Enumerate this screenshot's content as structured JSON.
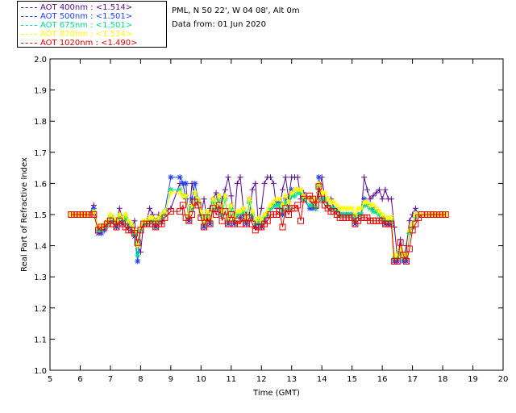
{
  "legend": [
    {
      "label": "AOT  400nm : <1.514>",
      "color": "#5a0a8c"
    },
    {
      "label": "AOT  500nm : <1.501>",
      "color": "#1e3cff"
    },
    {
      "label": "AOT  675nm : <1.501>",
      "color": "#00e08c"
    },
    {
      "label": "AOT  870nm : <1.514>",
      "color": "#ffff00"
    },
    {
      "label": "AOT 1020nm : <1.490>",
      "color": "#e60000"
    }
  ],
  "header": {
    "location": "PML, N 50 22', W 04 08', Alt 0m",
    "date": "Data from: 01 Jun 2020"
  },
  "chart_data": {
    "type": "line",
    "xlabel": "Time (GMT)",
    "ylabel": "Real Part of Refractive Index",
    "xlim": [
      5,
      20
    ],
    "ylim": [
      1.0,
      2.0
    ],
    "xticks": [
      "5",
      "6",
      "7",
      "8",
      "9",
      "10",
      "11",
      "12",
      "13",
      "14",
      "15",
      "16",
      "17",
      "18",
      "19",
      "20"
    ],
    "yticks": [
      "1.0",
      "1.1",
      "1.2",
      "1.3",
      "1.4",
      "1.5",
      "1.6",
      "1.7",
      "1.8",
      "1.9",
      "2.0"
    ],
    "x": [
      5.7,
      5.8,
      5.9,
      6.0,
      6.1,
      6.2,
      6.3,
      6.45,
      6.6,
      6.7,
      6.8,
      6.9,
      7.0,
      7.1,
      7.2,
      7.3,
      7.4,
      7.5,
      7.6,
      7.7,
      7.8,
      7.9,
      8.0,
      8.1,
      8.2,
      8.3,
      8.4,
      8.5,
      8.6,
      8.7,
      8.8,
      9.0,
      9.3,
      9.4,
      9.5,
      9.6,
      9.7,
      9.8,
      9.9,
      10.0,
      10.1,
      10.2,
      10.3,
      10.4,
      10.5,
      10.6,
      10.7,
      10.8,
      10.9,
      11.0,
      11.1,
      11.2,
      11.3,
      11.4,
      11.5,
      11.6,
      11.7,
      11.8,
      11.9,
      12.0,
      12.1,
      12.2,
      12.3,
      12.4,
      12.5,
      12.6,
      12.7,
      12.8,
      12.9,
      13.0,
      13.1,
      13.2,
      13.3,
      13.4,
      13.6,
      13.7,
      13.8,
      13.9,
      14.0,
      14.1,
      14.2,
      14.3,
      14.4,
      14.5,
      14.6,
      14.7,
      14.8,
      14.9,
      15.0,
      15.1,
      15.2,
      15.3,
      15.4,
      15.5,
      15.6,
      15.7,
      15.8,
      15.9,
      16.0,
      16.1,
      16.2,
      16.3,
      16.4,
      16.5,
      16.6,
      16.7,
      16.8,
      16.9,
      17.0,
      17.1,
      17.2,
      17.3,
      17.5,
      17.6,
      17.7,
      17.8,
      17.9,
      18.0,
      18.1,
      18.2,
      18.3
    ],
    "series": [
      {
        "values": [
          1.5,
          1.5,
          1.5,
          1.5,
          1.5,
          1.5,
          1.5,
          1.53,
          1.45,
          1.46,
          1.47,
          1.48,
          1.5,
          1.49,
          1.47,
          1.52,
          1.49,
          1.5,
          1.47,
          1.46,
          1.48,
          1.4,
          1.38,
          1.47,
          1.48,
          1.52,
          1.5,
          1.48,
          1.5,
          1.47,
          1.51,
          1.52,
          1.6,
          1.6,
          1.55,
          1.49,
          1.6,
          1.55,
          1.55,
          1.5,
          1.55,
          1.48,
          1.52,
          1.55,
          1.57,
          1.5,
          1.55,
          1.58,
          1.62,
          1.56,
          1.48,
          1.6,
          1.62,
          1.52,
          1.5,
          1.5,
          1.58,
          1.6,
          1.47,
          1.52,
          1.6,
          1.62,
          1.62,
          1.6,
          1.52,
          1.52,
          1.58,
          1.62,
          1.55,
          1.62,
          1.62,
          1.62,
          1.55,
          1.57,
          1.55,
          1.53,
          1.52,
          1.57,
          1.62,
          1.55,
          1.55,
          1.55,
          1.52,
          1.52,
          1.5,
          1.5,
          1.5,
          1.5,
          1.5,
          1.48,
          1.5,
          1.5,
          1.62,
          1.58,
          1.55,
          1.56,
          1.57,
          1.58,
          1.55,
          1.58,
          1.55,
          1.55,
          1.46,
          1.36,
          1.42,
          1.36,
          1.4,
          1.48,
          1.5,
          1.52,
          1.5,
          1.5,
          1.5,
          1.5,
          1.5,
          1.5,
          1.5,
          1.5,
          1.5
        ]
      },
      {
        "values": [
          1.5,
          1.5,
          1.5,
          1.5,
          1.5,
          1.5,
          1.5,
          1.52,
          1.44,
          1.44,
          1.45,
          1.47,
          1.49,
          1.48,
          1.46,
          1.5,
          1.47,
          1.49,
          1.46,
          1.45,
          1.43,
          1.35,
          1.45,
          1.47,
          1.47,
          1.48,
          1.48,
          1.46,
          1.48,
          1.5,
          1.51,
          1.62,
          1.62,
          1.6,
          1.6,
          1.48,
          1.55,
          1.6,
          1.55,
          1.5,
          1.46,
          1.5,
          1.47,
          1.55,
          1.52,
          1.56,
          1.5,
          1.56,
          1.47,
          1.53,
          1.47,
          1.5,
          1.49,
          1.5,
          1.47,
          1.55,
          1.49,
          1.46,
          1.47,
          1.46,
          1.48,
          1.5,
          1.52,
          1.53,
          1.54,
          1.54,
          1.5,
          1.55,
          1.52,
          1.58,
          1.58,
          1.58,
          1.58,
          1.55,
          1.52,
          1.52,
          1.52,
          1.62,
          1.55,
          1.55,
          1.53,
          1.52,
          1.52,
          1.51,
          1.5,
          1.5,
          1.5,
          1.5,
          1.5,
          1.47,
          1.5,
          1.5,
          1.55,
          1.54,
          1.53,
          1.52,
          1.51,
          1.5,
          1.49,
          1.47,
          1.47,
          1.47,
          1.35,
          1.35,
          1.38,
          1.35,
          1.35,
          1.44,
          1.46,
          1.5,
          1.5,
          1.5,
          1.5,
          1.5,
          1.5,
          1.5,
          1.5,
          1.5,
          1.5
        ]
      },
      {
        "values": [
          1.5,
          1.5,
          1.5,
          1.5,
          1.5,
          1.5,
          1.5,
          1.51,
          1.45,
          1.45,
          1.46,
          1.47,
          1.49,
          1.48,
          1.47,
          1.49,
          1.48,
          1.49,
          1.47,
          1.46,
          1.44,
          1.37,
          1.45,
          1.47,
          1.47,
          1.48,
          1.48,
          1.47,
          1.48,
          1.49,
          1.5,
          1.58,
          1.58,
          1.56,
          1.56,
          1.49,
          1.52,
          1.57,
          1.54,
          1.5,
          1.47,
          1.5,
          1.48,
          1.54,
          1.52,
          1.55,
          1.5,
          1.55,
          1.48,
          1.52,
          1.48,
          1.5,
          1.5,
          1.51,
          1.48,
          1.54,
          1.5,
          1.47,
          1.48,
          1.47,
          1.49,
          1.5,
          1.52,
          1.53,
          1.53,
          1.53,
          1.51,
          1.54,
          1.52,
          1.56,
          1.56,
          1.57,
          1.57,
          1.55,
          1.53,
          1.53,
          1.52,
          1.59,
          1.55,
          1.55,
          1.53,
          1.52,
          1.52,
          1.51,
          1.5,
          1.5,
          1.5,
          1.5,
          1.5,
          1.48,
          1.5,
          1.5,
          1.53,
          1.53,
          1.52,
          1.51,
          1.51,
          1.5,
          1.49,
          1.48,
          1.48,
          1.48,
          1.36,
          1.36,
          1.38,
          1.36,
          1.36,
          1.44,
          1.46,
          1.49,
          1.5,
          1.5,
          1.5,
          1.5,
          1.5,
          1.5,
          1.5,
          1.5,
          1.5
        ]
      },
      {
        "values": [
          1.5,
          1.5,
          1.5,
          1.5,
          1.5,
          1.5,
          1.5,
          1.51,
          1.46,
          1.46,
          1.47,
          1.48,
          1.5,
          1.49,
          1.48,
          1.5,
          1.49,
          1.5,
          1.48,
          1.47,
          1.45,
          1.4,
          1.46,
          1.48,
          1.48,
          1.49,
          1.49,
          1.48,
          1.49,
          1.5,
          1.51,
          1.57,
          1.57,
          1.56,
          1.56,
          1.5,
          1.53,
          1.57,
          1.55,
          1.51,
          1.48,
          1.51,
          1.49,
          1.55,
          1.53,
          1.56,
          1.51,
          1.56,
          1.49,
          1.53,
          1.49,
          1.51,
          1.51,
          1.52,
          1.49,
          1.55,
          1.51,
          1.48,
          1.49,
          1.48,
          1.5,
          1.51,
          1.53,
          1.54,
          1.55,
          1.55,
          1.53,
          1.56,
          1.54,
          1.57,
          1.58,
          1.58,
          1.58,
          1.56,
          1.55,
          1.55,
          1.54,
          1.6,
          1.57,
          1.57,
          1.55,
          1.54,
          1.54,
          1.53,
          1.52,
          1.52,
          1.52,
          1.52,
          1.52,
          1.5,
          1.52,
          1.52,
          1.54,
          1.54,
          1.53,
          1.53,
          1.52,
          1.51,
          1.5,
          1.49,
          1.49,
          1.49,
          1.37,
          1.37,
          1.39,
          1.37,
          1.37,
          1.45,
          1.47,
          1.5,
          1.5,
          1.5,
          1.5,
          1.5,
          1.5,
          1.5,
          1.5,
          1.5,
          1.5
        ]
      },
      {
        "values": [
          1.5,
          1.5,
          1.5,
          1.5,
          1.5,
          1.5,
          1.5,
          1.5,
          1.45,
          1.46,
          1.46,
          1.47,
          1.48,
          1.47,
          1.46,
          1.48,
          1.47,
          1.46,
          1.45,
          1.45,
          1.44,
          1.41,
          1.45,
          1.47,
          1.47,
          1.47,
          1.47,
          1.46,
          1.47,
          1.47,
          1.49,
          1.51,
          1.51,
          1.53,
          1.49,
          1.48,
          1.5,
          1.54,
          1.53,
          1.49,
          1.46,
          1.49,
          1.47,
          1.52,
          1.5,
          1.53,
          1.48,
          1.51,
          1.47,
          1.5,
          1.47,
          1.48,
          1.47,
          1.49,
          1.47,
          1.49,
          1.47,
          1.45,
          1.46,
          1.46,
          1.47,
          1.48,
          1.5,
          1.5,
          1.5,
          1.51,
          1.46,
          1.52,
          1.5,
          1.52,
          1.52,
          1.53,
          1.48,
          1.55,
          1.56,
          1.55,
          1.53,
          1.59,
          1.55,
          1.53,
          1.52,
          1.51,
          1.51,
          1.5,
          1.49,
          1.49,
          1.49,
          1.49,
          1.49,
          1.47,
          1.48,
          1.49,
          1.49,
          1.49,
          1.48,
          1.48,
          1.48,
          1.48,
          1.48,
          1.47,
          1.47,
          1.47,
          1.35,
          1.35,
          1.41,
          1.37,
          1.35,
          1.39,
          1.45,
          1.47,
          1.49,
          1.5,
          1.5,
          1.5,
          1.5,
          1.5,
          1.5,
          1.5,
          1.5
        ]
      }
    ],
    "series_marker": [
      "plus",
      "asterisk",
      "asterisk",
      "asterisk",
      "square"
    ],
    "grid": false
  }
}
